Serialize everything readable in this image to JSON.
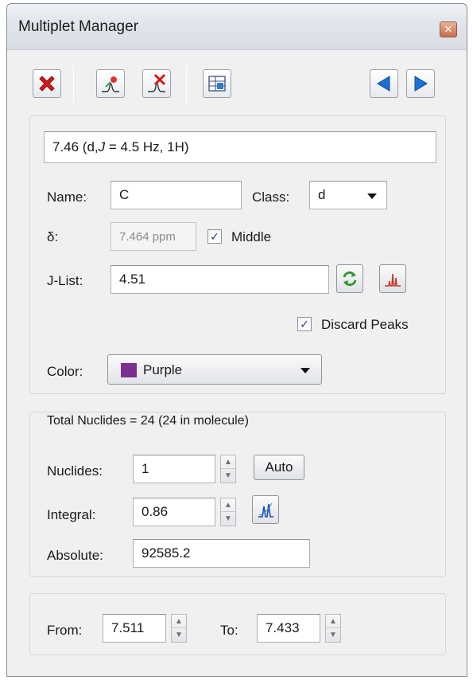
{
  "window": {
    "title": "Multiplet Manager"
  },
  "toolbar": {
    "delete_icon": "red-x-delete-icon",
    "add_multiplet_icon": "add-multiplet-icon",
    "remove_multiplet_icon": "remove-multiplet-icon",
    "table_icon": "table-report-icon",
    "prev_icon": "previous-arrow-icon",
    "next_icon": "next-arrow-icon"
  },
  "multiplet": {
    "summary_prefix": "7.46 (d, ",
    "summary_j": "J",
    "summary_suffix": " = 4.5 Hz, 1H)",
    "name_label": "Name:",
    "name_value": "C",
    "class_label": "Class:",
    "class_value": "d",
    "delta_label": "δ:",
    "delta_value": "7.464 ppm",
    "middle_label": "Middle",
    "middle_checked": true,
    "jlist_label": "J-List:",
    "jlist_value": "4.51",
    "discard_label": "Discard Peaks",
    "discard_checked": true,
    "color_label": "Color:",
    "color_value": "Purple",
    "color_hex": "#7b2f8e"
  },
  "nuclides": {
    "total_text": "Total Nuclides = 24 (24 in molecule)",
    "nuclides_label": "Nuclides:",
    "nuclides_value": "1",
    "auto_label": "Auto",
    "integral_label": "Integral:",
    "integral_value": "0.86",
    "absolute_label": "Absolute:",
    "absolute_value": "92585.2"
  },
  "range": {
    "from_label": "From:",
    "from_value": "7.511",
    "to_label": "To:",
    "to_value": "7.433"
  },
  "colors": {
    "accent_blue": "#1e6fd6",
    "delete_red": "#d11a1a",
    "refresh_green": "#2f9a2f"
  }
}
